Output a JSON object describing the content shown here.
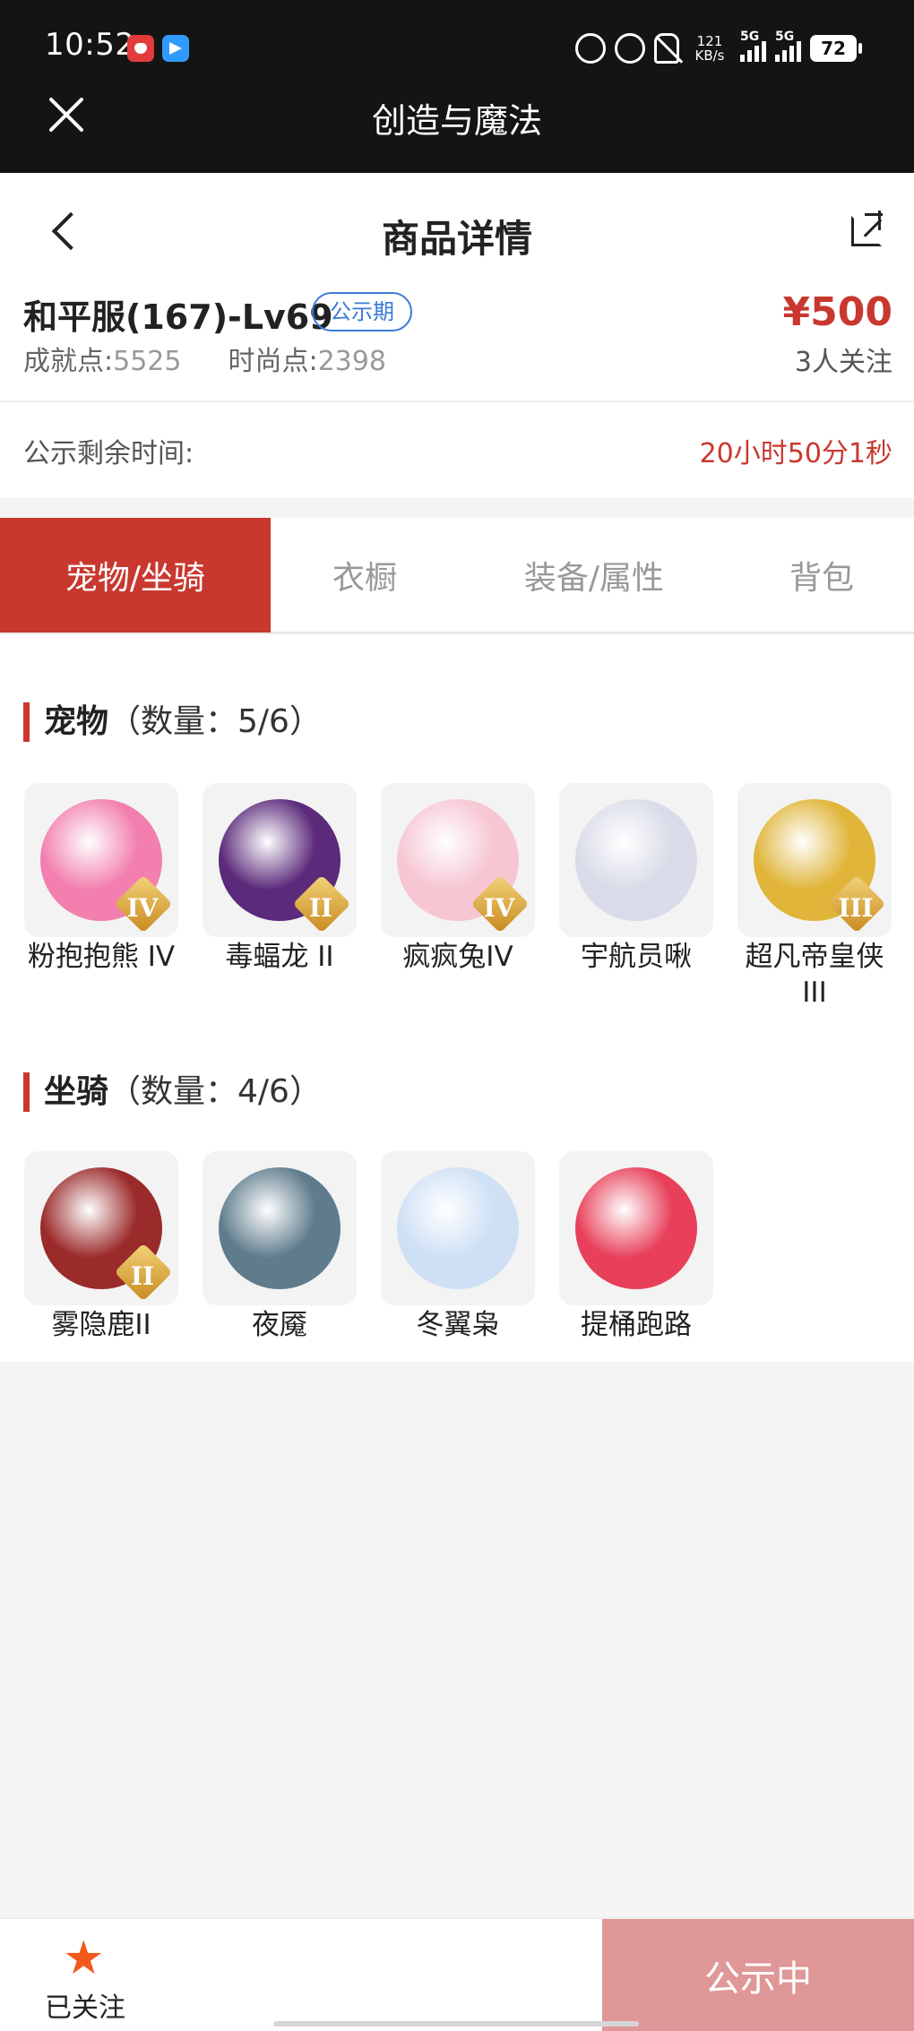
{
  "status_bar": {
    "time": "10:52",
    "net_speed": "121\nKB/s",
    "sim1": "5G",
    "sim2": "5G",
    "battery": "72"
  },
  "app_header": {
    "title": "创造与魔法"
  },
  "nav": {
    "title": "商品详情"
  },
  "item": {
    "name": "和平服(167)-Lv69",
    "badge": "公示期",
    "achievement_label": "成就点:",
    "achievement_value": "5525",
    "fashion_label": "时尚点:",
    "fashion_value": "2398",
    "price": "¥500",
    "followers": "3人关注"
  },
  "timer": {
    "label": "公示剩余时间:",
    "value": "20小时50分1秒"
  },
  "tabs": [
    {
      "label": "宠物/坐骑",
      "active": true
    },
    {
      "label": "衣橱",
      "active": false
    },
    {
      "label": "装备/属性",
      "active": false
    },
    {
      "label": "背包",
      "active": false
    }
  ],
  "pets": {
    "title": "宠物",
    "count_text": "（数量：5/6）",
    "items": [
      {
        "name": "粉抱抱熊 IV",
        "tier": "IV",
        "color": "#f27fae"
      },
      {
        "name": "毒蝠龙 II",
        "tier": "II",
        "color": "#5b2a7a"
      },
      {
        "name": "疯疯兔IV",
        "tier": "IV",
        "color": "#f6c6d3"
      },
      {
        "name": "宇航员啾",
        "tier": "",
        "color": "#d9dbe8"
      },
      {
        "name": "超凡帝皇侠 III",
        "tier": "III",
        "color": "#e0b53a"
      }
    ]
  },
  "mounts": {
    "title": "坐骑",
    "count_text": "（数量：4/6）",
    "items": [
      {
        "name": "雾隐鹿II",
        "tier": "II",
        "color": "#9b2a2a"
      },
      {
        "name": "夜魇",
        "tier": "",
        "color": "#5f7c8c"
      },
      {
        "name": "冬翼枭",
        "tier": "",
        "color": "#cfe0f5"
      },
      {
        "name": "提桶跑路",
        "tier": "",
        "color": "#e8405a"
      }
    ]
  },
  "bottom": {
    "follow_label": "已关注",
    "status_label": "公示中"
  }
}
